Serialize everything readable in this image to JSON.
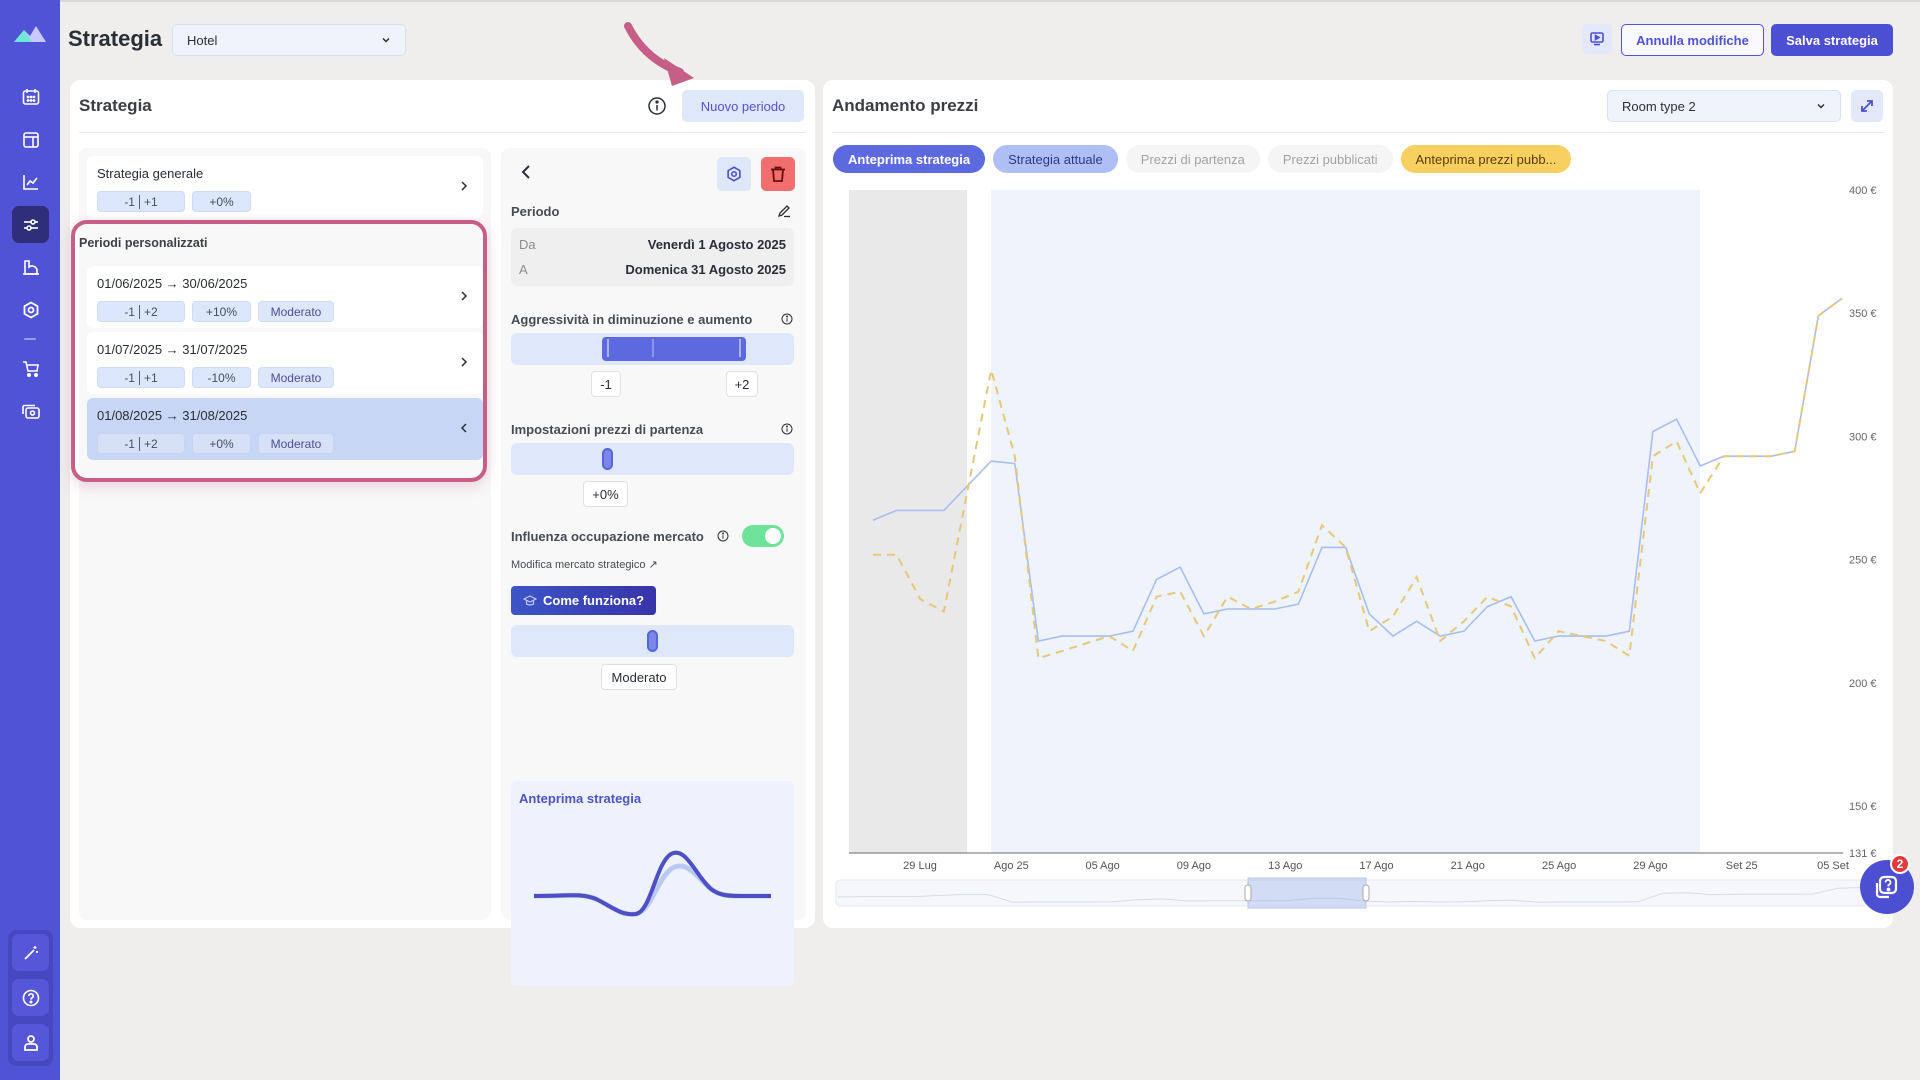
{
  "header": {
    "title": "Strategia",
    "property_select": "Hotel",
    "cancel_label": "Annulla modifiche",
    "save_label": "Salva strategia"
  },
  "sidebar": {
    "items": [
      {
        "icon": "calendar-icon"
      },
      {
        "icon": "layout-icon"
      },
      {
        "icon": "chart-line-icon"
      },
      {
        "icon": "sliders-icon",
        "active": true
      },
      {
        "icon": "building-icon"
      },
      {
        "icon": "gear-icon"
      },
      {
        "icon": "cart-icon"
      },
      {
        "icon": "money-icon"
      }
    ],
    "bottom": [
      {
        "icon": "magic-wand-icon"
      },
      {
        "icon": "help-icon"
      },
      {
        "icon": "user-icon"
      }
    ]
  },
  "strategy_card": {
    "title": "Strategia",
    "new_period_label": "Nuovo periodo",
    "general": {
      "label": "Strategia generale",
      "agg_down": "-1",
      "agg_up": "+1",
      "pct": "+0%"
    },
    "custom_label": "Periodi personalizzati",
    "periods": [
      {
        "range": "01/06/2025 → 30/06/2025",
        "agg_down": "-1",
        "agg_up": "+2",
        "pct": "+10%",
        "mode": "Moderato"
      },
      {
        "range": "01/07/2025 → 31/07/2025",
        "agg_down": "-1",
        "agg_up": "+1",
        "pct": "-10%",
        "mode": "Moderato"
      },
      {
        "range": "01/08/2025 → 31/08/2025",
        "agg_down": "-1",
        "agg_up": "+2",
        "pct": "+0%",
        "mode": "Moderato",
        "active": true
      }
    ]
  },
  "detail": {
    "period_label": "Periodo",
    "from_key": "Da",
    "from_value": "Venerdì 1 Agosto 2025",
    "to_key": "A",
    "to_value": "Domenica 31 Agosto 2025",
    "aggressiveness_label": "Aggressività in diminuzione e aumento",
    "agg_min": "-1",
    "agg_max": "+2",
    "start_price_label": "Impostazioni prezzi di partenza",
    "start_price_value": "+0%",
    "market_label": "Influenza occupazione mercato",
    "market_enabled": true,
    "market_link": "Modifica mercato strategico ↗",
    "how_label": "Come funziona?",
    "mode_value": "Moderato",
    "preview_title": "Anteprima strategia"
  },
  "prices_card": {
    "title": "Andamento prezzi",
    "room_select": "Room type 2",
    "pills": [
      "Anteprima strategia",
      "Strategia attuale",
      "Prezzi di partenza",
      "Prezzi pubblicati",
      "Anteprima prezzi pubb..."
    ],
    "chat_badge": "2"
  },
  "chart_data": {
    "type": "line",
    "title": "Andamento prezzi",
    "xlabel": "",
    "ylabel": "",
    "x_ticks": [
      "29 Lug",
      "Ago 25",
      "05 Ago",
      "09 Ago",
      "13 Ago",
      "17 Ago",
      "21 Ago",
      "25 Ago",
      "29 Ago",
      "Set 25",
      "05 Set"
    ],
    "y_ticks": [
      "400 €",
      "350 €",
      "300 €",
      "250 €",
      "200 €",
      "150 €",
      "131 €"
    ],
    "y_tick_values": [
      400,
      350,
      300,
      250,
      200,
      150,
      131
    ],
    "ylim": [
      131,
      400
    ],
    "grid": false,
    "series": [
      {
        "name": "Strategia attuale",
        "color": "#a9bdf0",
        "style": "solid",
        "values": [
          266,
          270,
          270,
          270,
          280,
          290,
          289,
          217,
          219,
          219,
          219,
          221,
          242,
          247,
          228,
          230,
          230,
          230,
          232,
          255,
          255,
          228,
          219,
          225,
          219,
          221,
          231,
          235,
          217,
          219,
          219,
          219,
          221,
          302,
          307,
          288,
          292,
          292,
          292,
          294,
          349,
          356
        ]
      },
      {
        "name": "Anteprima prezzi pubblicati",
        "color": "#e6c87a",
        "style": "dashed",
        "values": [
          252,
          252,
          234,
          229,
          278,
          327,
          292,
          210,
          213,
          216,
          219,
          213,
          235,
          237,
          219,
          235,
          230,
          233,
          237,
          264,
          255,
          221,
          227,
          243,
          217,
          225,
          235,
          231,
          210,
          221,
          219,
          217,
          211,
          292,
          298,
          277,
          292,
          292,
          292,
          294,
          349,
          356
        ]
      }
    ],
    "shaded_regions": [
      {
        "label": "past",
        "from_index": 0,
        "to_index": 4,
        "color": "#e9e9e9"
      },
      {
        "label": "selected period",
        "from_index": 5,
        "to_index": 35,
        "color": "#eef3fc"
      }
    ]
  }
}
